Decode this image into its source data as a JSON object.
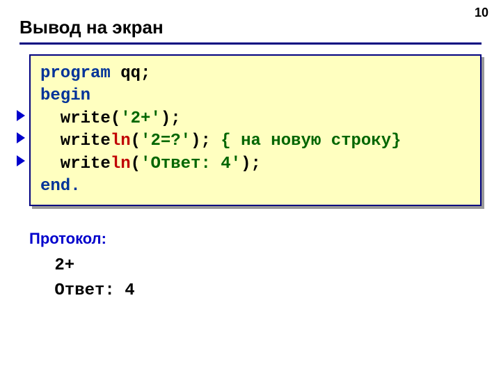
{
  "page_number": "10",
  "title": "Вывод на экран",
  "code": {
    "l1_kw": "program",
    "l1_rest": " qq;",
    "l2": "begin",
    "l3_fn": "  write",
    "l3_paren_open": "(",
    "l3_str": "'2+'",
    "l3_paren_close": ");",
    "l4_fn": "  write",
    "l4_ln": "ln",
    "l4_paren_open": "(",
    "l4_str": "'2=?'",
    "l4_paren_close": "); ",
    "l4_comment": "{ на новую строку}",
    "l5_fn": "  write",
    "l5_ln": "ln",
    "l5_paren_open": "(",
    "l5_str": "'Ответ: 4'",
    "l5_paren_close": ");",
    "l6": "end."
  },
  "protocol_label": "Протокол:",
  "output": {
    "line1": " 2+",
    "line2": " Ответ: 4"
  }
}
